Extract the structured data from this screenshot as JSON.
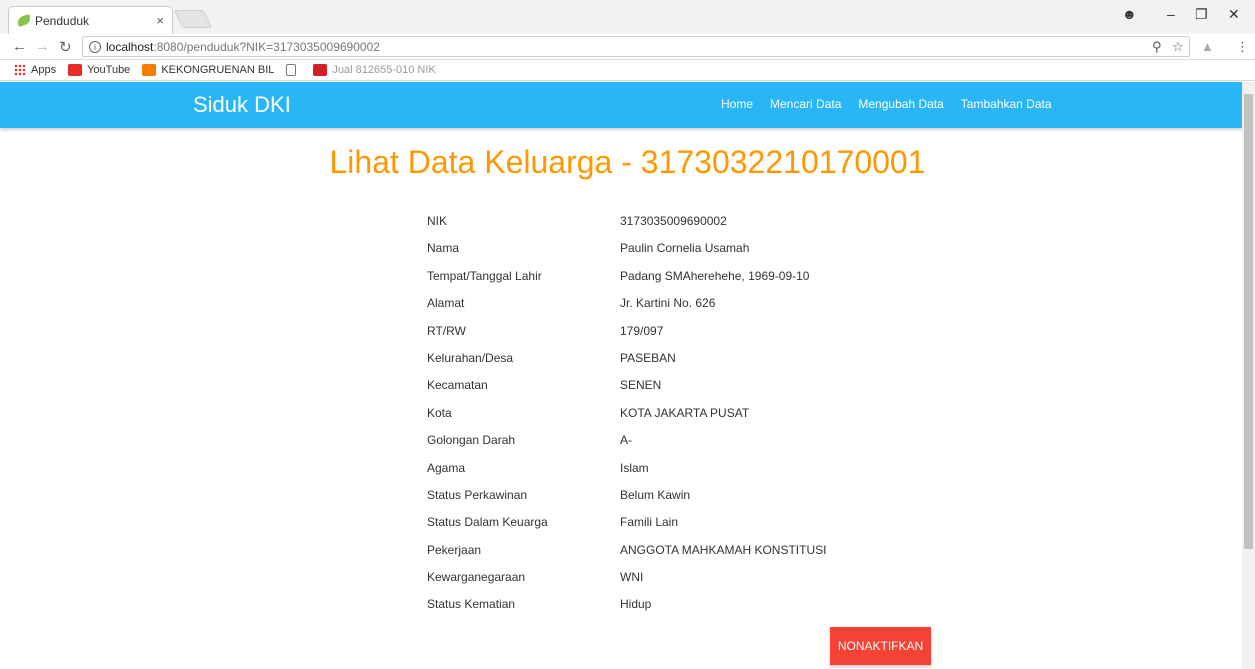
{
  "browser": {
    "tab_title": "Penduduk",
    "tab_close": "×",
    "url_host": "localhost",
    "url_path": ":8080/penduduk?NIK=3173035009690002",
    "bookmarks": [
      {
        "label": "Apps"
      },
      {
        "label": "YouTube"
      },
      {
        "label": "KEKONGRUENAN BIL"
      },
      {
        "label": ""
      },
      {
        "label": "Jual 812655-010 NIK"
      }
    ]
  },
  "navbar": {
    "brand": "Siduk DKI",
    "menu": [
      {
        "label": "Home"
      },
      {
        "label": "Mencari Data"
      },
      {
        "label": "Mengubah Data"
      },
      {
        "label": "Tambahkan Data"
      }
    ]
  },
  "heading": "Lihat Data Keluarga - 3173032210170001",
  "details": [
    {
      "label": "NIK",
      "value": "3173035009690002"
    },
    {
      "label": "Nama",
      "value": "Paulin Cornelia Usamah"
    },
    {
      "label": "Tempat/Tanggal Lahir",
      "value": "Padang SMAherehehe, 1969-09-10"
    },
    {
      "label": "Alamat",
      "value": "Jr. Kartini No. 626"
    },
    {
      "label": "RT/RW",
      "value": "179/097"
    },
    {
      "label": "Kelurahan/Desa",
      "value": "PASEBAN"
    },
    {
      "label": "Kecamatan",
      "value": "SENEN"
    },
    {
      "label": "Kota",
      "value": "KOTA JAKARTA PUSAT"
    },
    {
      "label": "Golongan Darah",
      "value": "A-"
    },
    {
      "label": "Agama",
      "value": "Islam"
    },
    {
      "label": "Status Perkawinan",
      "value": "Belum Kawin"
    },
    {
      "label": "Status Dalam Keuarga",
      "value": "Famili Lain"
    },
    {
      "label": "Pekerjaan",
      "value": "ANGGOTA MAHKAMAH KONSTITUSI"
    },
    {
      "label": "Kewarganegaraan",
      "value": "WNI"
    },
    {
      "label": "Status Kematian",
      "value": "Hidup"
    }
  ],
  "action_button": "NONAKTIFKAN",
  "colors": {
    "navbar": "#29b6f6",
    "heading": "#ff9800",
    "button": "#f44336"
  }
}
